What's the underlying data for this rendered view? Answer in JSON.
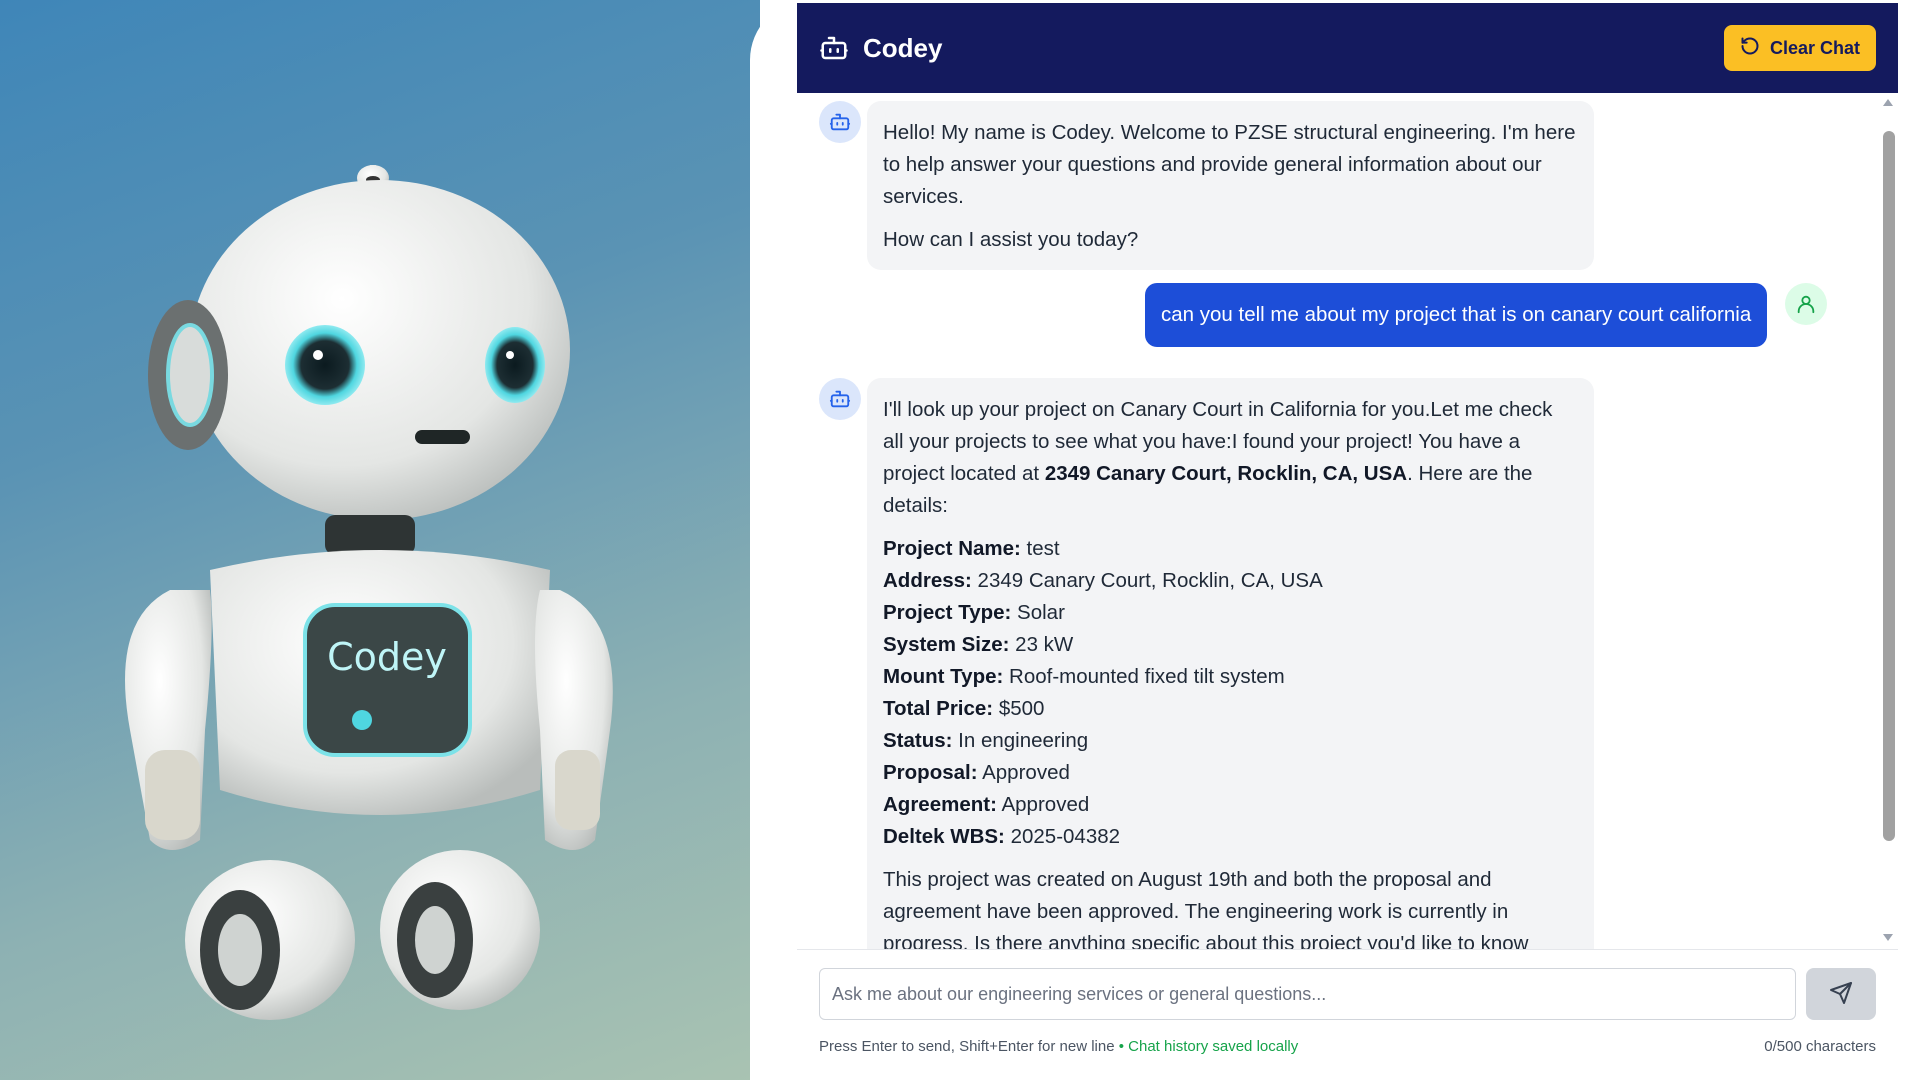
{
  "hero": {
    "robot_chest_label": "Codey"
  },
  "header": {
    "title": "Codey",
    "clear_label": "Clear Chat"
  },
  "messages": {
    "m1": {
      "p1": "Hello! My name is Codey. Welcome to PZSE structural engineering. I'm here to help answer your questions and provide general information about our services.",
      "p2": "How can I assist you today?"
    },
    "m2": {
      "text": "can you tell me about my project that is on canary court california"
    },
    "m3": {
      "intro_a": "I'll look up your project on Canary Court in California for you.Let me check all your projects to see what you have:I found your project! You have a project located at ",
      "intro_bold": "2349 Canary Court, Rocklin, CA, USA",
      "intro_b": ". Here are the details:",
      "details": [
        {
          "label": "Project Name:",
          "value": " test"
        },
        {
          "label": "Address:",
          "value": " 2349 Canary Court, Rocklin, CA, USA"
        },
        {
          "label": "Project Type:",
          "value": " Solar"
        },
        {
          "label": "System Size:",
          "value": " 23 kW"
        },
        {
          "label": "Mount Type:",
          "value": " Roof-mounted fixed tilt system"
        },
        {
          "label": "Total Price:",
          "value": " $500"
        },
        {
          "label": "Status:",
          "value": " In engineering"
        },
        {
          "label": "Proposal:",
          "value": " Approved"
        },
        {
          "label": "Agreement:",
          "value": " Approved"
        },
        {
          "label": "Deltek WBS:",
          "value": " 2025-04382"
        }
      ],
      "closing": "This project was created on August 19th and both the proposal and agreement have been approved. The engineering work is currently in progress. Is there anything specific about this project you'd like to know"
    }
  },
  "composer": {
    "placeholder": "Ask me about our engineering services or general questions...",
    "value": "",
    "hint": "Press Enter to send, Shift+Enter for new line",
    "saved": "• Chat history saved locally",
    "counter": "0/500 characters"
  },
  "colors": {
    "header_bg": "#141a5e",
    "clear_button": "#fbbf24",
    "user_bubble": "#1d4ed8",
    "bot_bubble": "#f3f4f6"
  },
  "icons": {
    "brand": "bot-icon",
    "clear": "refresh-icon",
    "user": "user-icon",
    "send": "send-icon"
  }
}
